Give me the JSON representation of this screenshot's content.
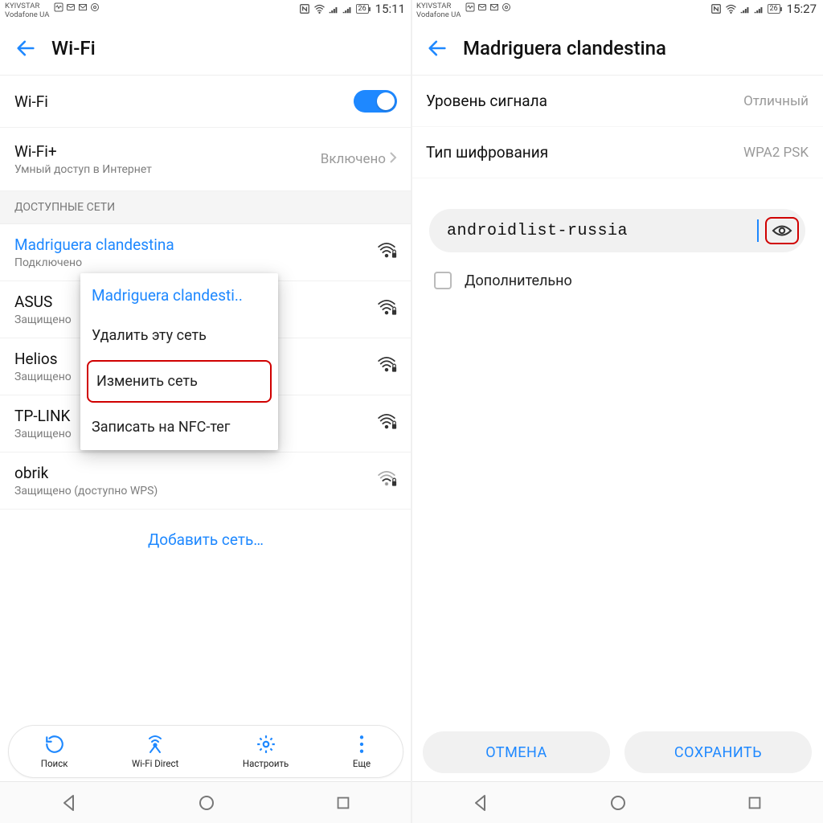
{
  "left": {
    "status": {
      "carrier1": "KYIVSTAR",
      "carrier2": "Vodafone UA",
      "time": "15:11",
      "battery": "26"
    },
    "header": {
      "title": "Wi-Fi"
    },
    "wifi_row": {
      "label": "Wi-Fi",
      "on": true
    },
    "wifi_plus": {
      "label": "Wi-Fi+",
      "sub": "Умный доступ в Интернет",
      "value": "Включено"
    },
    "section": "ДОСТУПНЫЕ СЕТИ",
    "networks": [
      {
        "name": "Madriguera clandestina",
        "status": "Подключено",
        "connected": true
      },
      {
        "name": "ASUS",
        "status": "Защищено"
      },
      {
        "name": "Helios",
        "status": "Защищено"
      },
      {
        "name": "TP-LINK",
        "status": "Защищено"
      },
      {
        "name": "obrik",
        "status": "Защищено (доступно WPS)",
        "weak": true
      }
    ],
    "add_network": "Добавить сеть…",
    "ctx": {
      "title": "Madriguera clandesti..",
      "items": [
        "Удалить эту сеть",
        "Изменить сеть",
        "Записать на NFC-тег"
      ]
    },
    "toolbar": {
      "refresh": "Поиск",
      "direct": "Wi-Fi Direct",
      "settings": "Настроить",
      "more": "Еще"
    }
  },
  "right": {
    "status": {
      "carrier1": "KYIVSTAR",
      "carrier2": "Vodafone UA",
      "time": "15:27",
      "battery": "26"
    },
    "header": {
      "title": "Madriguera clandestina"
    },
    "signal": {
      "k": "Уровень сигнала",
      "v": "Отличный"
    },
    "enc": {
      "k": "Тип шифрования",
      "v": "WPA2 PSK"
    },
    "password": "androidlist-russia",
    "extra": "Дополнительно",
    "btn_cancel": "ОТМЕНА",
    "btn_save": "СОХРАНИТЬ"
  }
}
